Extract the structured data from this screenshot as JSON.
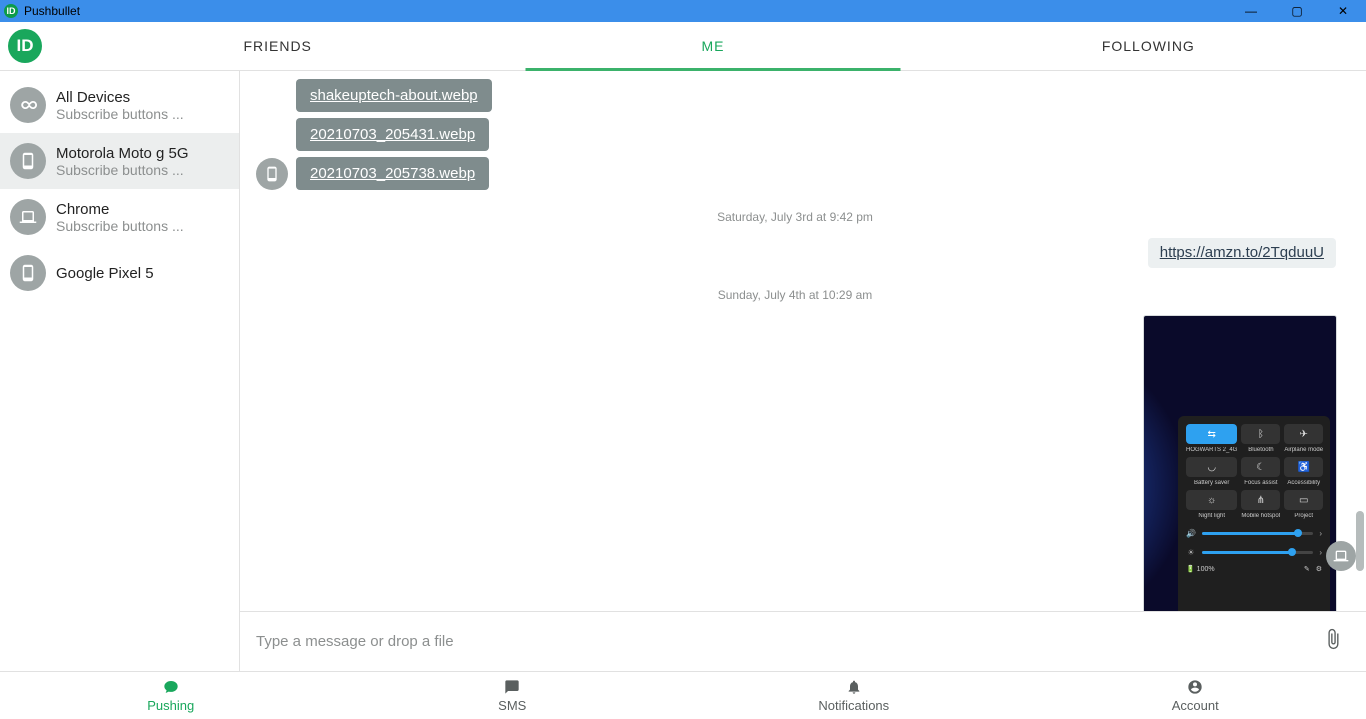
{
  "window": {
    "title": "Pushbullet"
  },
  "tabs": {
    "friends": "FRIENDS",
    "me": "ME",
    "following": "FOLLOWING"
  },
  "devices": [
    {
      "name": "All Devices",
      "sub": "Subscribe buttons ...",
      "icon": "infinity"
    },
    {
      "name": "Motorola Moto g 5G",
      "sub": "Subscribe buttons ...",
      "icon": "phone"
    },
    {
      "name": "Chrome",
      "sub": "Subscribe buttons ...",
      "icon": "laptop"
    },
    {
      "name": "Google Pixel 5",
      "sub": "",
      "icon": "phone"
    }
  ],
  "files": [
    "shakeuptech-about.webp",
    "20210703_205431.webp",
    "20210703_205738.webp"
  ],
  "sep1": "Saturday, July 3rd at 9:42 pm",
  "link1": "https://amzn.to/2TqduuU",
  "sep2": "Sunday, July 4th at 10:29 am",
  "qs": {
    "tiles": [
      {
        "label": "HOGWARTS 2_4G",
        "active": true,
        "glyph": "⇆"
      },
      {
        "label": "Bluetooth",
        "active": false,
        "glyph": "ᛒ"
      },
      {
        "label": "Airplane mode",
        "active": false,
        "glyph": "✈"
      },
      {
        "label": "Battery saver",
        "active": false,
        "glyph": "◡"
      },
      {
        "label": "Focus assist",
        "active": false,
        "glyph": "☾"
      },
      {
        "label": "Accessibility",
        "active": false,
        "glyph": "♿"
      },
      {
        "label": "Night light",
        "active": false,
        "glyph": "☼"
      },
      {
        "label": "Mobile hotspot",
        "active": false,
        "glyph": "⋔"
      },
      {
        "label": "Project",
        "active": false,
        "glyph": "▭"
      }
    ],
    "battery": "100%"
  },
  "composer": {
    "placeholder": "Type a message or drop a file"
  },
  "bottom": {
    "pushing": "Pushing",
    "sms": "SMS",
    "notifications": "Notifications",
    "account": "Account"
  }
}
